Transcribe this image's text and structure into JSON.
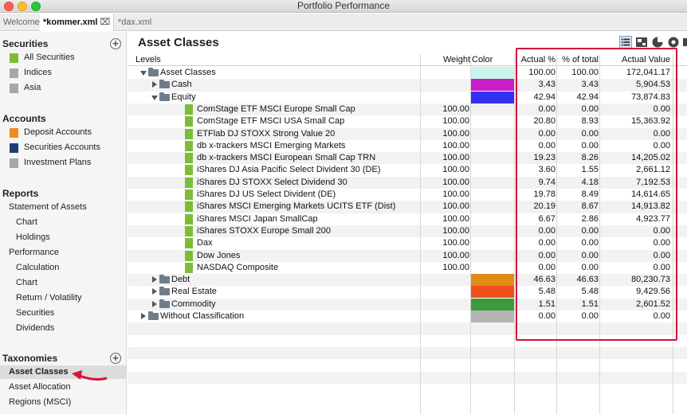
{
  "window": {
    "title": "Portfolio Performance"
  },
  "tabs": [
    {
      "label": "Welcome"
    },
    {
      "label": "*kommer.xml",
      "close": "⌧"
    },
    {
      "label": "*dax.xml"
    }
  ],
  "sidebar": {
    "securities": {
      "title": "Securities",
      "items": [
        {
          "label": "All Securities",
          "icon_color": "#7cbd36"
        },
        {
          "label": "Indices",
          "icon_color": "#a7a7a7"
        },
        {
          "label": "Asia",
          "icon_color": "#a7a7a7"
        }
      ]
    },
    "accounts": {
      "title": "Accounts",
      "items": [
        {
          "label": "Deposit Accounts",
          "icon_color": "#f08c1e"
        },
        {
          "label": "Securities Accounts",
          "icon_color": "#1f3d6e"
        },
        {
          "label": "Investment Plans",
          "icon_color": "#a7a7a7"
        }
      ]
    },
    "reports": {
      "title": "Reports",
      "items": [
        "Statement of Assets",
        "Chart",
        "Holdings",
        "Performance",
        "Calculation",
        "Chart",
        "Return / Volatility",
        "Securities",
        "Dividends"
      ]
    },
    "taxonomies": {
      "title": "Taxonomies",
      "items": [
        "Asset Classes",
        "Asset Allocation",
        "Regions (MSCI)"
      ]
    }
  },
  "main": {
    "title": "Asset Classes",
    "columns": {
      "levels": "Levels",
      "weight": "Weight",
      "color": "Color",
      "actual_pct": "Actual %",
      "pct_total": "% of total",
      "actual_value": "Actual Value"
    },
    "rows": [
      {
        "label": "Asset Classes",
        "level": 0,
        "kind": "folder",
        "tw": "open",
        "weight": "",
        "color": "#c8f5ec",
        "actual": "100.00",
        "total": "100.00",
        "value": "172,041.17"
      },
      {
        "label": "Cash",
        "level": 1,
        "kind": "folder",
        "tw": "closed",
        "weight": "",
        "color": "#c81ec8",
        "actual": "3.43",
        "total": "3.43",
        "value": "5,904.53"
      },
      {
        "label": "Equity",
        "level": 1,
        "kind": "folder",
        "tw": "open",
        "weight": "",
        "color": "#3232f0",
        "actual": "42.94",
        "total": "42.94",
        "value": "73,874.83"
      },
      {
        "label": "ComStage ETF MSCI Europe Small Cap",
        "level": 2,
        "kind": "sec",
        "weight": "100.00",
        "color": "",
        "actual": "0.00",
        "total": "0.00",
        "value": "0.00"
      },
      {
        "label": "ComStage ETF MSCI USA Small Cap",
        "level": 2,
        "kind": "sec",
        "weight": "100.00",
        "color": "",
        "actual": "20.80",
        "total": "8.93",
        "value": "15,363.92"
      },
      {
        "label": "ETFlab DJ STOXX Strong Value 20",
        "level": 2,
        "kind": "sec",
        "weight": "100.00",
        "color": "",
        "actual": "0.00",
        "total": "0.00",
        "value": "0.00"
      },
      {
        "label": "db x-trackers MSCI Emerging Markets",
        "level": 2,
        "kind": "sec",
        "weight": "100.00",
        "color": "",
        "actual": "0.00",
        "total": "0.00",
        "value": "0.00"
      },
      {
        "label": "db x-trackers MSCI European Small Cap TRN",
        "level": 2,
        "kind": "sec",
        "weight": "100.00",
        "color": "",
        "actual": "19.23",
        "total": "8.26",
        "value": "14,205.02"
      },
      {
        "label": "iShares DJ Asia Pacific Select Divident 30 (DE)",
        "level": 2,
        "kind": "sec",
        "weight": "100.00",
        "color": "",
        "actual": "3.60",
        "total": "1.55",
        "value": "2,661.12"
      },
      {
        "label": "iShares DJ STOXX Select Dividend 30",
        "level": 2,
        "kind": "sec",
        "weight": "100.00",
        "color": "",
        "actual": "9.74",
        "total": "4.18",
        "value": "7,192.53"
      },
      {
        "label": "iShares DJ US Select Divident (DE)",
        "level": 2,
        "kind": "sec",
        "weight": "100.00",
        "color": "",
        "actual": "19.78",
        "total": "8.49",
        "value": "14,614.65"
      },
      {
        "label": "iShares MSCI Emerging Markets UCITS ETF (Dist)",
        "level": 2,
        "kind": "sec",
        "weight": "100.00",
        "color": "",
        "actual": "20.19",
        "total": "8.67",
        "value": "14,913.82"
      },
      {
        "label": "iShares MSCI Japan SmallCap",
        "level": 2,
        "kind": "sec",
        "weight": "100.00",
        "color": "",
        "actual": "6.67",
        "total": "2.86",
        "value": "4,923.77"
      },
      {
        "label": "iShares STOXX Europe Small 200",
        "level": 2,
        "kind": "sec",
        "weight": "100.00",
        "color": "",
        "actual": "0.00",
        "total": "0.00",
        "value": "0.00"
      },
      {
        "label": "Dax",
        "level": 2,
        "kind": "sec",
        "weight": "100.00",
        "color": "",
        "actual": "0.00",
        "total": "0.00",
        "value": "0.00"
      },
      {
        "label": "Dow Jones",
        "level": 2,
        "kind": "sec",
        "weight": "100.00",
        "color": "",
        "actual": "0.00",
        "total": "0.00",
        "value": "0.00"
      },
      {
        "label": "NASDAQ Composite",
        "level": 2,
        "kind": "sec",
        "weight": "100.00",
        "color": "",
        "actual": "0.00",
        "total": "0.00",
        "value": "0.00"
      },
      {
        "label": "Debt",
        "level": 1,
        "kind": "folder",
        "tw": "closed",
        "weight": "",
        "color": "#e08c14",
        "actual": "46.63",
        "total": "46.63",
        "value": "80,230.73"
      },
      {
        "label": "Real Estate",
        "level": 1,
        "kind": "folder",
        "tw": "closed",
        "weight": "",
        "color": "#f0501e",
        "actual": "5.48",
        "total": "5.48",
        "value": "9,429.56"
      },
      {
        "label": "Commodity",
        "level": 1,
        "kind": "folder",
        "tw": "closed",
        "weight": "",
        "color": "#3c9a3c",
        "actual": "1.51",
        "total": "1.51",
        "value": "2,601.52"
      },
      {
        "label": "Without Classification",
        "level": 0,
        "kind": "folder",
        "tw": "closed",
        "weight": "",
        "color": "#b4b4b4",
        "actual": "0.00",
        "total": "0.00",
        "value": "0.00"
      }
    ]
  }
}
